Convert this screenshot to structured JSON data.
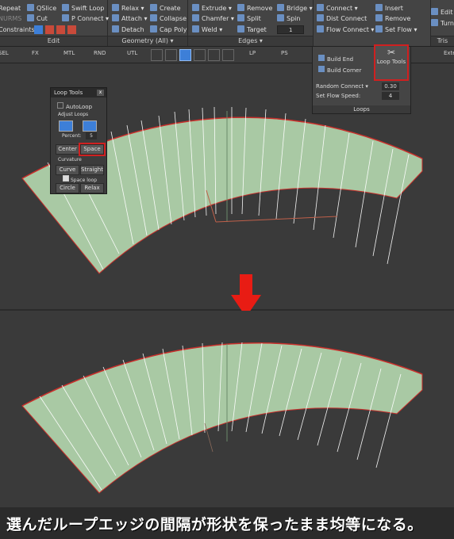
{
  "ribbon": {
    "edit": {
      "items": [
        "Repeat",
        "QSlice",
        "Swift Loop",
        "NURMS",
        "Cut",
        "P Connect",
        "Constraints:"
      ],
      "label": "Edit"
    },
    "geometry": {
      "items": [
        "Relax",
        "Create",
        "Attach",
        "Collapse",
        "Detach",
        "Cap Poly"
      ],
      "label": "Geometry (All)"
    },
    "edges": {
      "items": [
        "Extrude",
        "Remove",
        "Bridge",
        "Chamfer",
        "Split",
        "Spin",
        "Weld",
        "Target"
      ],
      "spin_value": "1",
      "label": "Edges"
    },
    "loops": {
      "items": [
        "Connect",
        "Insert",
        "Dist Connect",
        "Remove",
        "Flow Connect",
        "Set Flow"
      ],
      "label": "Loops"
    },
    "tris": {
      "items": [
        "Edit T",
        "Turn"
      ],
      "label": "Tris"
    }
  },
  "tabbar": {
    "labels": [
      "SEL",
      "FX",
      "MTL",
      "RND",
      "UTL",
      "LP",
      "PS",
      "Exte"
    ]
  },
  "loops_panel": {
    "build_end": "Build End",
    "build_corner": "Build Corner",
    "loop_tools": "Loop Tools",
    "random_connect": "Random Connect",
    "random_value": "0.30",
    "set_flow_speed": "Set Flow Speed:",
    "flow_speed_value": "4",
    "footer": "Loops"
  },
  "loop_tools_float": {
    "title": "Loop Tools",
    "autoloop": "AutoLoop",
    "adjust_loops": "Adjust Loops",
    "percent_label": "Percent:",
    "percent_value": "5",
    "center": "Center",
    "space": "Space",
    "curvature": "Curvature",
    "curve": "Curve",
    "straight": "Straight",
    "space_loop": "Space loop",
    "circle": "Circle",
    "relax": "Relax"
  },
  "caption": "選んだループエッジの間隔が形状を保ったまま均等になる。",
  "colors": {
    "mesh": "#a9c9a4",
    "edge_red": "#c8302c",
    "arrow": "#e81c14"
  }
}
